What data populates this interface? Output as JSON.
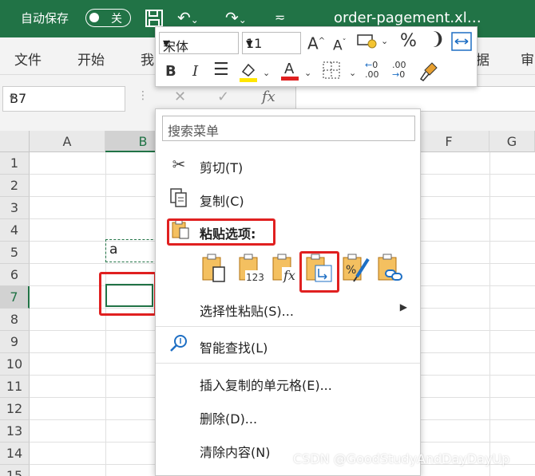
{
  "titlebar": {
    "autosave_label": "自动保存",
    "toggle_state": "关",
    "filename": "order-pagement.xl…"
  },
  "tabs": [
    "文件",
    "开始",
    "我",
    "据",
    "审"
  ],
  "formula_bar": {
    "name_box": "B7",
    "fx_label": "fx"
  },
  "grid": {
    "columns": [
      "A",
      "B",
      "",
      "",
      "",
      "F",
      "G"
    ],
    "rows": [
      "1",
      "2",
      "3",
      "4",
      "5",
      "6",
      "7",
      "8",
      "9",
      "10",
      "11",
      "12",
      "13",
      "14",
      "15"
    ],
    "copied_cell_value": "a"
  },
  "minibar": {
    "font_name": "宋体",
    "font_size": "11",
    "bold": "B",
    "italic": "I",
    "percent": "%",
    "comma": "❩",
    "grow_font": "A",
    "shrink_font": "A",
    "font_color": "A",
    "inc_decimal": ".00",
    "dec_decimal": ".00"
  },
  "context_menu": {
    "search_placeholder": "搜索菜单",
    "items": {
      "cut": "剪切(T)",
      "copy": "复制(C)",
      "paste_options": "粘贴选项:",
      "paste_special": "选择性粘贴(S)...",
      "smart_lookup": "智能查找(L)",
      "insert_copied": "插入复制的单元格(E)...",
      "delete": "删除(D)...",
      "clear": "清除内容(N)"
    },
    "paste_buttons": {
      "values": "123",
      "formulas": "fx",
      "percent": "%"
    }
  },
  "watermark": "CSDN @GoodStudyAndDayDayUp",
  "colors": {
    "accent": "#217346",
    "highlight": "#e02020"
  }
}
